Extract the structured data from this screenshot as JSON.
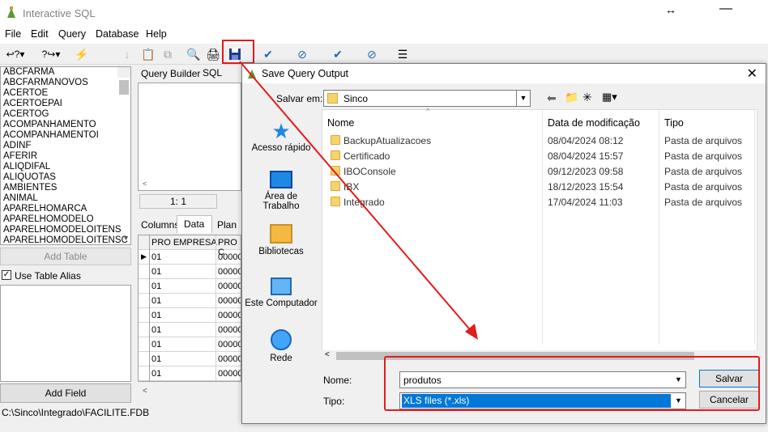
{
  "app": {
    "title": "Interactive SQL"
  },
  "menu": [
    "File",
    "Edit",
    "Query",
    "Database",
    "Help"
  ],
  "tables": [
    "ABCFARMA",
    "ABCFARMANOVOS",
    "ACERTOE",
    "ACERTOEPAI",
    "ACERTOG",
    "ACOMPANHAMENTO",
    "ACOMPANHAMENTOI",
    "ADINF",
    "AFERIR",
    "ALIQDIFAL",
    "ALIQUOTAS",
    "AMBIENTES",
    "ANIMAL",
    "APARELHOMARCA",
    "APARELHOMODELO",
    "APARELHOMODELOITENS",
    "APARELHOMODELOITENSC"
  ],
  "left_panel": {
    "add_table": "Add Table",
    "use_alias": "Use Table Alias",
    "add_field": "Add Field"
  },
  "query_tabs": {
    "builder": "Query Builder",
    "sql": "SQL"
  },
  "position": "1:  1",
  "result_tabs": {
    "columns": "Columns",
    "data": "Data",
    "plan": "Plan"
  },
  "grid": {
    "headers": [
      "PRO EMPRESA",
      "PRO C"
    ],
    "rows": [
      [
        "01",
        "00000"
      ],
      [
        "01",
        "00000"
      ],
      [
        "01",
        "00000"
      ],
      [
        "01",
        "00000"
      ],
      [
        "01",
        "00000"
      ],
      [
        "01",
        "00000"
      ],
      [
        "01",
        "00000"
      ],
      [
        "01",
        "00000"
      ],
      [
        "01",
        "00000"
      ]
    ]
  },
  "statusbar": {
    "path": "C:\\Sinco\\Integrado\\FACILITE.FDB"
  },
  "dialog": {
    "title": "Save Query Output",
    "save_in_label": "Salvar em:",
    "save_in_value": "Sinco",
    "places": [
      "Acesso rápido",
      "Área de Trabalho",
      "Bibliotecas",
      "Este Computador",
      "Rede"
    ],
    "columns": [
      "Nome",
      "Data de modificação",
      "Tipo"
    ],
    "files": [
      {
        "name": "BackupAtualizacoes",
        "date": "08/04/2024 08:12",
        "type": "Pasta de arquivos"
      },
      {
        "name": "Certificado",
        "date": "08/04/2024 15:57",
        "type": "Pasta de arquivos"
      },
      {
        "name": "IBOConsole",
        "date": "09/12/2023 09:58",
        "type": "Pasta de arquivos"
      },
      {
        "name": "IBX",
        "date": "18/12/2023 15:54",
        "type": "Pasta de arquivos"
      },
      {
        "name": "Integrado",
        "date": "17/04/2024 11:03",
        "type": "Pasta de arquivos"
      }
    ],
    "name_label": "Nome:",
    "name_value": "produtos",
    "type_label": "Tipo:",
    "type_value": "XLS files (*.xls)",
    "save_button": "Salvar",
    "cancel_button": "Cancelar"
  },
  "colors": {
    "highlight": "#0078d7",
    "annotation_red": "#e21c1c"
  }
}
